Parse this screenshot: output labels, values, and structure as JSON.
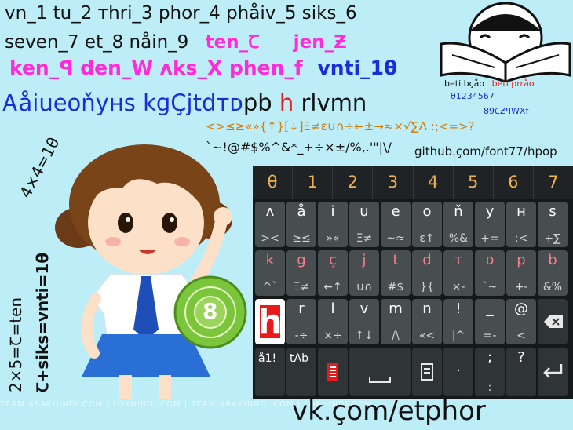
{
  "lines": {
    "numbers1": "vn_1 tu_2 ᴛhri_3 phor_4 phåiv_5 siks_6",
    "numbers2a": "seven_7 et_8 nåin_9",
    "numbers2b": "ten_Ꞇ",
    "numbers2c": "jen_Ƶ",
    "line3a": "ken_ꟼ den_W ʌks_X phen_f",
    "line3b": "vnti_1θ",
    "alpha_a": "Ꭺåiueoňyʜs kgÇjtd",
    "alpha_b": "ᴛᴅ",
    "alpha_c": "pb ",
    "alpha_d": "h",
    "alpha_e": " rlvmn",
    "symbols1": "<>≤≥«»{↑}[↓]Ξ≠ɛ∪∩÷←±→≈×√∑Λ :;<=>?",
    "symbols2": "`~!@#$%^&*_+÷×±/%,.'\"|\\/",
    "github": "github.çom/font77/hpop",
    "vk": "vk.çom/etphor",
    "watermark": "TEAM ARAKHINDI.COM  |  LOKHINDI.COM  |  TEAM ARAKHINDI.COM  |  LOKHINDI.COM",
    "vertical1": "4×4=1θ",
    "vertical2": "2×5=Ꞇ=ten",
    "vertical3": "Ꞇ+siks=vnti=1θ"
  },
  "logo": {
    "line1a": "beti bçåo",
    "line1b": "beti prråo",
    "line2": "θ1234567",
    "line3": "89ꞆƵꟼWXf"
  },
  "coin": {
    "digit": "8"
  },
  "keyboard": {
    "numrow": [
      "θ",
      "1",
      "2",
      "3",
      "4",
      "5",
      "6",
      "7"
    ],
    "row1": [
      {
        "p": "ʌ",
        "s": "><"
      },
      {
        "p": "å",
        "s": "≥≤"
      },
      {
        "p": "i",
        "s": "»«"
      },
      {
        "p": "u",
        "s": "Ξ≠"
      },
      {
        "p": "e",
        "s": "~≈"
      },
      {
        "p": "o",
        "s": "ɛ↑"
      },
      {
        "p": "ň",
        "s": "%&"
      },
      {
        "p": "y",
        "s": "+="
      },
      {
        "p": "ʜ",
        "s": ":<"
      },
      {
        "p": "s",
        "s": "+∑"
      }
    ],
    "row2": [
      {
        "p": "k",
        "s": "^`"
      },
      {
        "p": "g",
        "s": "Ξ≠"
      },
      {
        "p": "ç",
        "s": "←↑"
      },
      {
        "p": "j",
        "s": "∪∩"
      },
      {
        "p": "t",
        "s": "#$"
      },
      {
        "p": "d",
        "s": "}{"
      },
      {
        "p": "ᴛ",
        "s": "×-"
      },
      {
        "p": "ᴅ",
        "s": "`~"
      },
      {
        "p": "p",
        "s": "+-"
      },
      {
        "p": "b",
        "s": "&%"
      }
    ],
    "row3": [
      {
        "p": "r",
        "s": "-÷"
      },
      {
        "p": "l",
        "s": "×÷"
      },
      {
        "p": "v",
        "s": "↑↓"
      },
      {
        "p": "m",
        "s": "/\\"
      },
      {
        "p": "n",
        "s": "«<"
      },
      {
        "p": "!",
        "s": "|^"
      },
      {
        "p": "_",
        "s": "=-"
      },
      {
        "p": "@",
        "s": "<"
      }
    ],
    "big_h": "h",
    "row4": {
      "k1": "å1!",
      "k2": "tAb",
      "period": ".",
      "semicolon": ";",
      "colon": ":",
      "question": "?"
    }
  },
  "colors": {
    "background": "#bdeef7",
    "magenta": "#ff2bd8",
    "blue": "#1a2ed8",
    "red": "#e81b1b",
    "orange": "#f0b14a",
    "keyboard": "#15191b"
  }
}
